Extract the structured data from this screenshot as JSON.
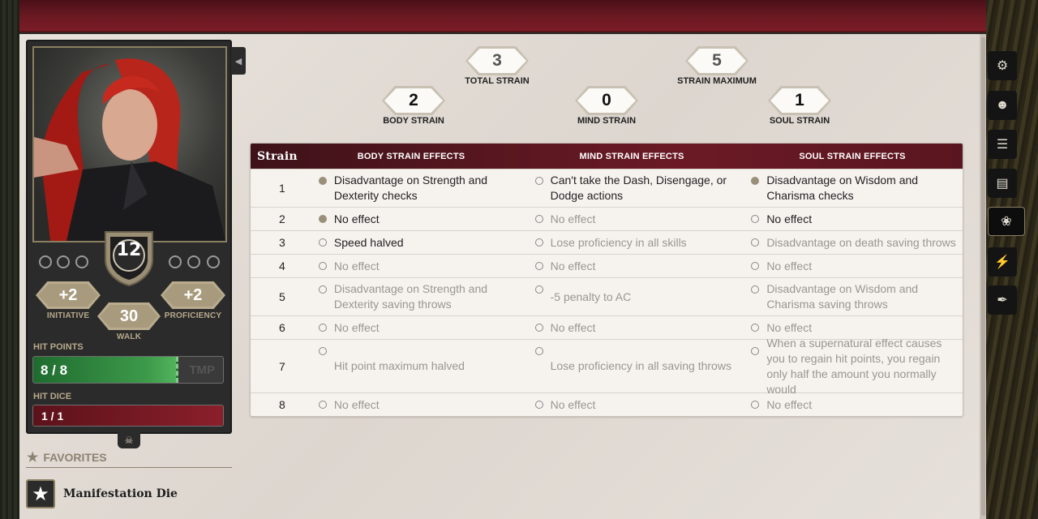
{
  "character": {
    "armor_class": "12",
    "initiative": {
      "value": "+2",
      "label": "INITIATIVE"
    },
    "proficiency": {
      "value": "+2",
      "label": "PROFICIENCY"
    },
    "walk": {
      "value": "30",
      "label": "WALK"
    },
    "hit_points": {
      "label": "HIT POINTS",
      "current": "8",
      "max": "8",
      "text": "8 / 8",
      "temp_placeholder": "TMP",
      "fill_fraction": 1.0
    },
    "hit_dice": {
      "label": "HIT DICE",
      "text": "1 / 1",
      "fill_fraction": 1.0
    }
  },
  "favorites": {
    "heading": "FAVORITES",
    "items": [
      {
        "label": "Manifestation Die"
      }
    ]
  },
  "strain": {
    "total": {
      "value": "3",
      "label": "TOTAL STRAIN"
    },
    "maximum": {
      "value": "5",
      "label": "STRAIN MAXIMUM"
    },
    "body": {
      "value": "2",
      "label": "BODY STRAIN"
    },
    "mind": {
      "value": "0",
      "label": "MIND STRAIN"
    },
    "soul": {
      "value": "1",
      "label": "SOUL STRAIN"
    }
  },
  "table": {
    "headers": {
      "strain": "Strain",
      "body": "BODY STRAIN EFFECTS",
      "mind": "MIND STRAIN EFFECTS",
      "soul": "SOUL STRAIN EFFECTS"
    },
    "rows": [
      {
        "n": "1",
        "body": "Disadvantage on Strength and Dexterity checks",
        "mind": "Can't take the Dash, Disengage, or Dodge actions",
        "soul": "Disadvantage on Wisdom and Charisma checks"
      },
      {
        "n": "2",
        "body": "No effect",
        "mind": "No effect",
        "soul": "No effect"
      },
      {
        "n": "3",
        "body": "Speed halved",
        "mind": "Lose proficiency in all skills",
        "soul": "Disadvantage on death saving throws"
      },
      {
        "n": "4",
        "body": "No effect",
        "mind": "No effect",
        "soul": "No effect"
      },
      {
        "n": "5",
        "body": "Disadvantage on Strength and Dexterity saving throws",
        "mind": "-5 penalty to AC",
        "soul": "Disadvantage on Wisdom and Charisma saving throws"
      },
      {
        "n": "6",
        "body": "No effect",
        "mind": "No effect",
        "soul": "No effect"
      },
      {
        "n": "7",
        "body": "Hit point maximum halved",
        "mind": "Lose proficiency in all saving throws",
        "soul": "When a supernatural effect causes you to regain hit points, you regain only half the amount you normally would"
      },
      {
        "n": "8",
        "body": "No effect",
        "mind": "No effect",
        "soul": "No effect"
      }
    ]
  },
  "sidebar_icons": [
    "gear-icon",
    "character-icon",
    "list-icon",
    "book-icon",
    "brain-icon",
    "lightning-icon",
    "feather-icon"
  ],
  "colors": {
    "accent": "#6b1a25",
    "hp_green": "#3d9a4a",
    "hit_dice_red": "#8a1f2a",
    "gold": "#b7a98b"
  }
}
